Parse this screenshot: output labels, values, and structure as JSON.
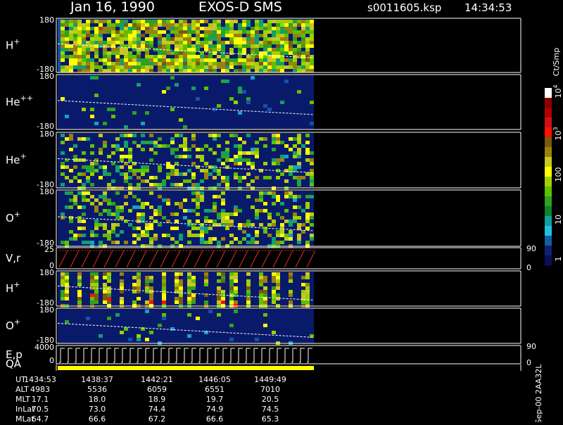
{
  "header": {
    "date": "Jan 16, 1990",
    "instrument": "EXOS-D SMS",
    "file": "s0011605.ksp",
    "time": "14:34:53"
  },
  "colorbar": {
    "unit_label": "Ct/Smp",
    "tick_labels": [
      "1",
      "10",
      "100",
      "10",
      "10"
    ],
    "tick_exponents": [
      "",
      "",
      "",
      "3",
      "4"
    ],
    "colors": [
      "#ffffff",
      "#8b0000",
      "#b00000",
      "#d01010",
      "#ff1000",
      "#7a5a10",
      "#9a8010",
      "#c8c820",
      "#ffff00",
      "#a0d000",
      "#60c000",
      "#30a020",
      "#108030",
      "#10a0a0",
      "#20c0e0",
      "#1060a0",
      "#102070",
      "#0a1058"
    ]
  },
  "panels": [
    {
      "id": "H+",
      "label_base": "H",
      "label_sup": "+",
      "ytop": "180",
      "ybot": "-180",
      "right_top": "",
      "right_bot": ""
    },
    {
      "id": "He++",
      "label_base": "He",
      "label_sup": "++",
      "ytop": "180",
      "ybot": "-180",
      "right_top": "",
      "right_bot": ""
    },
    {
      "id": "He+",
      "label_base": "He",
      "label_sup": "+",
      "ytop": "180",
      "ybot": "-180",
      "right_top": "",
      "right_bot": ""
    },
    {
      "id": "O+",
      "label_base": "O",
      "label_sup": "+",
      "ytop": "180",
      "ybot": "-180",
      "right_top": "",
      "right_bot": ""
    },
    {
      "id": "V,r",
      "label_base": "V,r",
      "label_sup": "",
      "ytop": "25",
      "ybot": "0",
      "right_top": "90",
      "right_bot": "0"
    },
    {
      "id": "H+2",
      "label_base": "H",
      "label_sup": "+",
      "ytop": "180",
      "ybot": "-180",
      "right_top": "",
      "right_bot": ""
    },
    {
      "id": "O+2",
      "label_base": "O",
      "label_sup": "+",
      "ytop": "180",
      "ybot": "-180",
      "right_top": "",
      "right_bot": ""
    },
    {
      "id": "E,p",
      "label_base": "E,p",
      "label_sup": "",
      "ytop": "4000",
      "ybot": "0",
      "right_top": "90",
      "right_bot": "0"
    },
    {
      "id": "QA",
      "label_base": "QA",
      "label_sup": "",
      "ytop": "",
      "ybot": "",
      "right_top": "",
      "right_bot": ""
    }
  ],
  "footer": {
    "row_labels": [
      "UT",
      "ALT",
      "MLT",
      "InLat",
      "MLat"
    ],
    "columns": [
      [
        "1434:53",
        "4983",
        "17.1",
        "70.5",
        "64.7"
      ],
      [
        "1438:37",
        "5536",
        "18.0",
        "73.0",
        "66.6"
      ],
      [
        "1442:21",
        "6059",
        "18.9",
        "74.4",
        "67.2"
      ],
      [
        "1446:05",
        "6551",
        "19.7",
        "74.9",
        "66.6"
      ],
      [
        "1449:49",
        "7010",
        "20.5",
        "74.5",
        "65.3"
      ]
    ],
    "side_label": "Sep-00  2AA32L"
  },
  "chart_data": {
    "type": "heatmap",
    "title": "Jan 16, 1990   EXOS-D SMS",
    "x": [
      "1434:53",
      "1438:37",
      "1442:21",
      "1446:05",
      "1449:49"
    ],
    "series": [
      {
        "name": "H+",
        "ylim": [
          -180,
          180
        ]
      },
      {
        "name": "He++",
        "ylim": [
          -180,
          180
        ]
      },
      {
        "name": "He+",
        "ylim": [
          -180,
          180
        ]
      },
      {
        "name": "O+",
        "ylim": [
          -180,
          180
        ]
      },
      {
        "name": "V,r",
        "ylim": [
          0,
          25
        ],
        "ylim_right": [
          0,
          90
        ]
      },
      {
        "name": "H+",
        "ylim": [
          -180,
          180
        ]
      },
      {
        "name": "O+",
        "ylim": [
          -180,
          180
        ]
      },
      {
        "name": "E,p",
        "ylim": [
          0,
          4000
        ],
        "ylim_right": [
          0,
          90
        ]
      },
      {
        "name": "QA"
      }
    ],
    "colorbar": {
      "label": "Ct/Smp",
      "scale": "log",
      "range": [
        1,
        10000
      ]
    }
  }
}
